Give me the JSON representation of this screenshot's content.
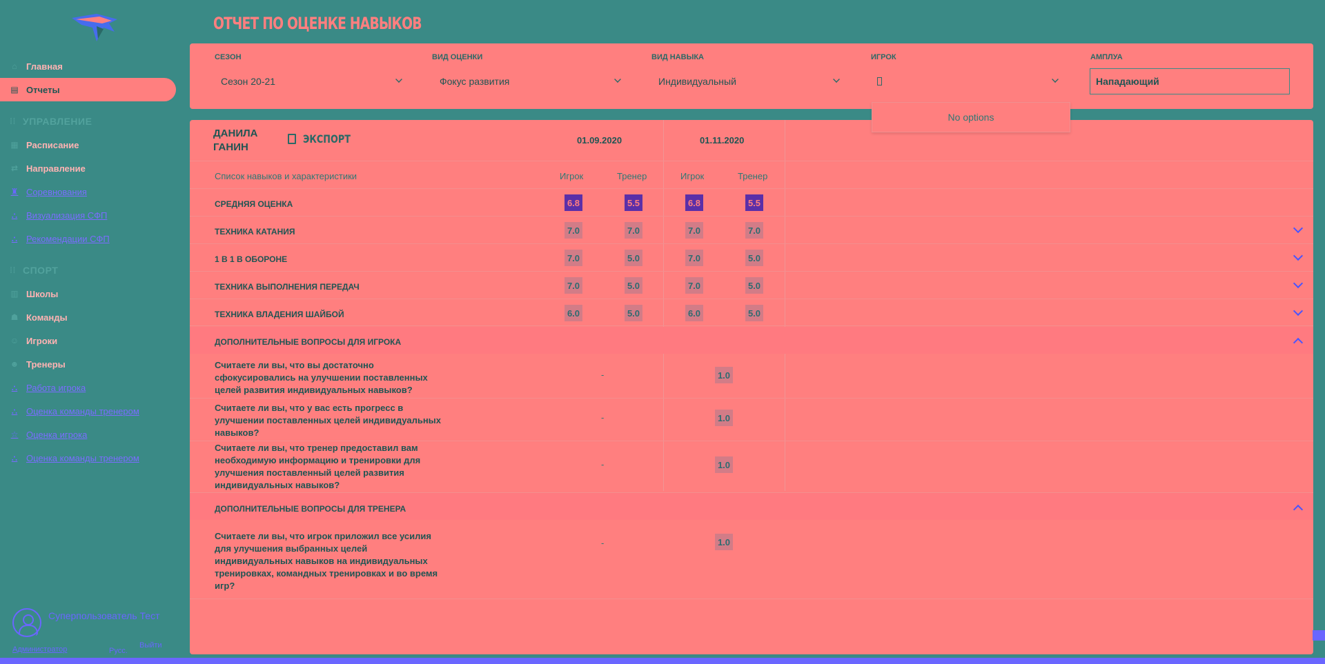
{
  "sidebar": {
    "items": [
      {
        "label": "Главная",
        "icon": "home-icon"
      },
      {
        "label": "Отчеты",
        "icon": "report-icon",
        "active": true
      },
      {
        "label": "Расписание",
        "icon": "calendar-icon"
      },
      {
        "label": "Направление",
        "icon": "direction-icon"
      },
      {
        "label": "Соревнования",
        "icon": "trophy-icon"
      },
      {
        "label": "Визуализация СФП",
        "icon": "chart-icon"
      },
      {
        "label": "Рекомендации СФП",
        "icon": "list-icon"
      },
      {
        "label": "Школы",
        "icon": "school-icon"
      },
      {
        "label": "Команды",
        "icon": "team-icon"
      },
      {
        "label": "Игроки",
        "icon": "player-icon"
      },
      {
        "label": "Тренеры",
        "icon": "coach-icon"
      },
      {
        "label": "Работа игрока",
        "icon": "work-icon"
      },
      {
        "label": "Оценка команды тренером",
        "icon": "rating-icon"
      },
      {
        "label": "Оценка игрока",
        "icon": "star-icon"
      },
      {
        "label": "Оценка команды тренером",
        "icon": "rating-icon"
      }
    ],
    "sections": {
      "management": "УПРАВЛЕНИЕ",
      "sport": "СПОРТ"
    },
    "user": {
      "name": "Суперпользователь Тест",
      "role": "Администратор",
      "lang": "Русс.",
      "exit": "Выйти"
    }
  },
  "header": {
    "title": "ОТЧЕТ ПО ОЦЕНКЕ НАВЫКОВ"
  },
  "filters": {
    "season": {
      "label": "СЕЗОН",
      "value": "Сезон 20-21"
    },
    "rating_type": {
      "label": "ВИД ОЦЕНКИ",
      "value": "Фокус развития"
    },
    "skill_type": {
      "label": "ВИД НАВЫКА",
      "value": "Индивидуальный"
    },
    "player": {
      "label": "ИГРОК",
      "value": "",
      "dropdown_text": "No options"
    },
    "position": {
      "label": "АМПЛУА",
      "value": "Нападающий"
    }
  },
  "report": {
    "player_name": [
      "ДАНИЛА",
      "ГАНИН"
    ],
    "export_label": "ЭКСПОРТ",
    "dates": [
      "01.09.2020",
      "01.11.2020"
    ],
    "column_list": "Список навыков и характеристики",
    "col_player": "Игрок",
    "col_coach": "Тренер",
    "skills": [
      {
        "name": "СРЕДНЯЯ ОЦЕНКА",
        "values": [
          "6.8",
          "5.5",
          "6.8",
          "5.5"
        ],
        "highlight": true
      },
      {
        "name": "ТЕХНИКА КАТАНИЯ",
        "values": [
          "7.0",
          "7.0",
          "7.0",
          "7.0"
        ]
      },
      {
        "name": "1 В 1 В ОБОРОНЕ",
        "values": [
          "7.0",
          "5.0",
          "7.0",
          "5.0"
        ]
      },
      {
        "name": "ТЕХНИКА ВЫПОЛНЕНИЯ ПЕРЕДАЧ",
        "values": [
          "7.0",
          "5.0",
          "7.0",
          "5.0"
        ]
      },
      {
        "name": "ТЕХНИКА ВЛАДЕНИЯ ШАЙБОЙ",
        "values": [
          "6.0",
          "5.0",
          "6.0",
          "5.0"
        ]
      }
    ],
    "player_section": {
      "title": "ДОПОЛНИТЕЛЬНЫЕ ВОПРОСЫ ДЛЯ ИГРОКА",
      "questions": [
        {
          "text": "Считаете ли вы, что вы достаточно сфокусировались на улучшении поставленных целей развития индивидуальных навыков?",
          "first": "-",
          "second": "1.0"
        },
        {
          "text": "Считаете ли вы, что у вас есть прогресс в улучшении поставленных целей индивидуальных навыков?",
          "first": "-",
          "second": "1.0"
        },
        {
          "text": "Считаете ли вы, что тренер предоставил вам необходимую информацию и тренировки для улучшения поставленный целей развития индивидуальных навыков?",
          "first": "-",
          "second": "1.0"
        }
      ]
    },
    "coach_section": {
      "title": "ДОПОЛНИТЕЛЬНЫЕ ВОПРОСЫ ДЛЯ ТРЕНЕРА",
      "questions": [
        {
          "text": "Считаете ли вы, что игрок приложил все усилия для улучшения выбранных целей индивидуальных навыков на индивидуальных тренировках, командных тренировках и во время игр?",
          "first": "-",
          "second": "1.0"
        }
      ]
    }
  },
  "colors": {
    "background": "#3a8a86",
    "panel": "#ff7f7f",
    "accent": "#6a66ff",
    "highlight": "#5b2fa8"
  }
}
